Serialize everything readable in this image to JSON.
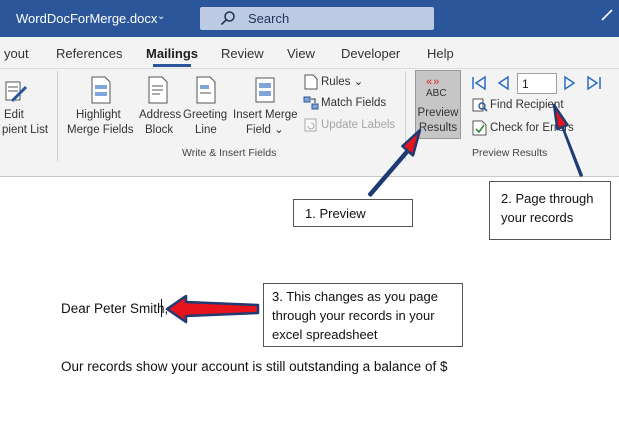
{
  "titlebar": {
    "doc_title": "WordDocForMerge.docx",
    "chevron": "⌄",
    "search_label": "Search",
    "background_color": "#2b579a"
  },
  "ribbon": {
    "tabs": [
      {
        "label": "yout",
        "active": false
      },
      {
        "label": "References",
        "active": false
      },
      {
        "label": "Mailings",
        "active": true
      },
      {
        "label": "Review",
        "active": false
      },
      {
        "label": "View",
        "active": false
      },
      {
        "label": "Developer",
        "active": false
      },
      {
        "label": "Help",
        "active": false
      }
    ],
    "left_cut": {
      "line1": "Edit",
      "line2": "pient List"
    },
    "write_insert": {
      "highlight": {
        "line1": "Highlight",
        "line2": "Merge Fields"
      },
      "address": {
        "line1": "Address",
        "line2": "Block"
      },
      "greeting": {
        "line1": "Greeting",
        "line2": "Line"
      },
      "insert_merge": {
        "line1": "Insert Merge",
        "line2": "Field ⌄"
      },
      "rules": "Rules ⌄",
      "match_fields": "Match Fields",
      "update_labels": "Update Labels",
      "group_label": "Write & Insert Fields"
    },
    "preview": {
      "chevrons": "«»",
      "abc": "ABC",
      "line1": "Preview",
      "line2": "Results",
      "record_number": "1",
      "find_recipient": "Find Recipient",
      "check_errors": "Check for Errors",
      "group_label": "Preview Results"
    }
  },
  "callouts": {
    "preview": "1. Preview",
    "page_through": {
      "line1": "2.  Page through",
      "line2": "your records"
    },
    "changes": {
      "line1": "3. This changes as you page",
      "line2": "through your records in your",
      "line3": "excel spreadsheet"
    }
  },
  "document": {
    "greeting": "Dear Peter Smith,",
    "body_line": "Our records show your account is still outstanding a balance of $"
  },
  "colors": {
    "accent": "#2b579a",
    "arrow_fill": "#e8141c",
    "arrow_outline": "#1f3b73"
  }
}
